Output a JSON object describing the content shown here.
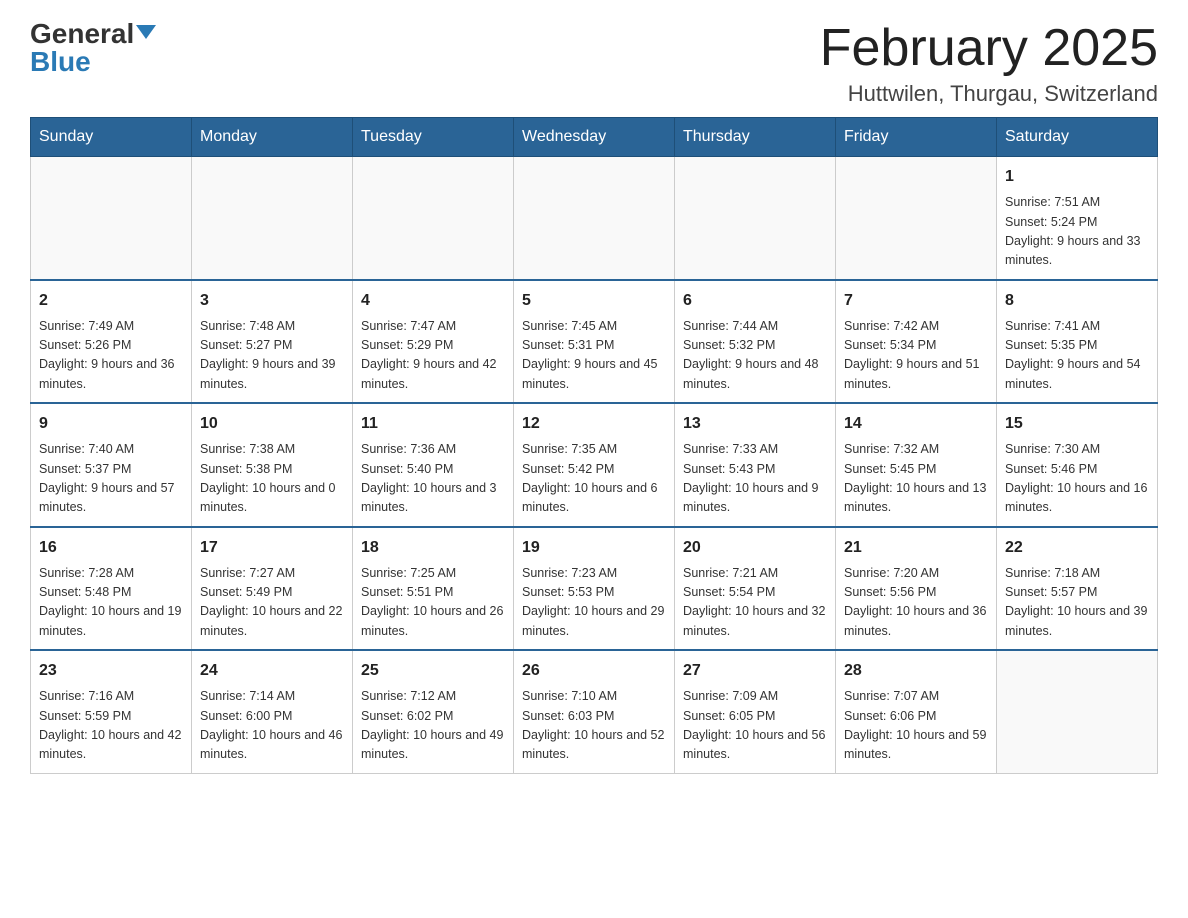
{
  "header": {
    "logo_general": "General",
    "logo_blue": "Blue",
    "month_title": "February 2025",
    "location": "Huttwilen, Thurgau, Switzerland"
  },
  "days_of_week": [
    "Sunday",
    "Monday",
    "Tuesday",
    "Wednesday",
    "Thursday",
    "Friday",
    "Saturday"
  ],
  "weeks": [
    [
      {
        "day": "",
        "info": ""
      },
      {
        "day": "",
        "info": ""
      },
      {
        "day": "",
        "info": ""
      },
      {
        "day": "",
        "info": ""
      },
      {
        "day": "",
        "info": ""
      },
      {
        "day": "",
        "info": ""
      },
      {
        "day": "1",
        "info": "Sunrise: 7:51 AM\nSunset: 5:24 PM\nDaylight: 9 hours and 33 minutes."
      }
    ],
    [
      {
        "day": "2",
        "info": "Sunrise: 7:49 AM\nSunset: 5:26 PM\nDaylight: 9 hours and 36 minutes."
      },
      {
        "day": "3",
        "info": "Sunrise: 7:48 AM\nSunset: 5:27 PM\nDaylight: 9 hours and 39 minutes."
      },
      {
        "day": "4",
        "info": "Sunrise: 7:47 AM\nSunset: 5:29 PM\nDaylight: 9 hours and 42 minutes."
      },
      {
        "day": "5",
        "info": "Sunrise: 7:45 AM\nSunset: 5:31 PM\nDaylight: 9 hours and 45 minutes."
      },
      {
        "day": "6",
        "info": "Sunrise: 7:44 AM\nSunset: 5:32 PM\nDaylight: 9 hours and 48 minutes."
      },
      {
        "day": "7",
        "info": "Sunrise: 7:42 AM\nSunset: 5:34 PM\nDaylight: 9 hours and 51 minutes."
      },
      {
        "day": "8",
        "info": "Sunrise: 7:41 AM\nSunset: 5:35 PM\nDaylight: 9 hours and 54 minutes."
      }
    ],
    [
      {
        "day": "9",
        "info": "Sunrise: 7:40 AM\nSunset: 5:37 PM\nDaylight: 9 hours and 57 minutes."
      },
      {
        "day": "10",
        "info": "Sunrise: 7:38 AM\nSunset: 5:38 PM\nDaylight: 10 hours and 0 minutes."
      },
      {
        "day": "11",
        "info": "Sunrise: 7:36 AM\nSunset: 5:40 PM\nDaylight: 10 hours and 3 minutes."
      },
      {
        "day": "12",
        "info": "Sunrise: 7:35 AM\nSunset: 5:42 PM\nDaylight: 10 hours and 6 minutes."
      },
      {
        "day": "13",
        "info": "Sunrise: 7:33 AM\nSunset: 5:43 PM\nDaylight: 10 hours and 9 minutes."
      },
      {
        "day": "14",
        "info": "Sunrise: 7:32 AM\nSunset: 5:45 PM\nDaylight: 10 hours and 13 minutes."
      },
      {
        "day": "15",
        "info": "Sunrise: 7:30 AM\nSunset: 5:46 PM\nDaylight: 10 hours and 16 minutes."
      }
    ],
    [
      {
        "day": "16",
        "info": "Sunrise: 7:28 AM\nSunset: 5:48 PM\nDaylight: 10 hours and 19 minutes."
      },
      {
        "day": "17",
        "info": "Sunrise: 7:27 AM\nSunset: 5:49 PM\nDaylight: 10 hours and 22 minutes."
      },
      {
        "day": "18",
        "info": "Sunrise: 7:25 AM\nSunset: 5:51 PM\nDaylight: 10 hours and 26 minutes."
      },
      {
        "day": "19",
        "info": "Sunrise: 7:23 AM\nSunset: 5:53 PM\nDaylight: 10 hours and 29 minutes."
      },
      {
        "day": "20",
        "info": "Sunrise: 7:21 AM\nSunset: 5:54 PM\nDaylight: 10 hours and 32 minutes."
      },
      {
        "day": "21",
        "info": "Sunrise: 7:20 AM\nSunset: 5:56 PM\nDaylight: 10 hours and 36 minutes."
      },
      {
        "day": "22",
        "info": "Sunrise: 7:18 AM\nSunset: 5:57 PM\nDaylight: 10 hours and 39 minutes."
      }
    ],
    [
      {
        "day": "23",
        "info": "Sunrise: 7:16 AM\nSunset: 5:59 PM\nDaylight: 10 hours and 42 minutes."
      },
      {
        "day": "24",
        "info": "Sunrise: 7:14 AM\nSunset: 6:00 PM\nDaylight: 10 hours and 46 minutes."
      },
      {
        "day": "25",
        "info": "Sunrise: 7:12 AM\nSunset: 6:02 PM\nDaylight: 10 hours and 49 minutes."
      },
      {
        "day": "26",
        "info": "Sunrise: 7:10 AM\nSunset: 6:03 PM\nDaylight: 10 hours and 52 minutes."
      },
      {
        "day": "27",
        "info": "Sunrise: 7:09 AM\nSunset: 6:05 PM\nDaylight: 10 hours and 56 minutes."
      },
      {
        "day": "28",
        "info": "Sunrise: 7:07 AM\nSunset: 6:06 PM\nDaylight: 10 hours and 59 minutes."
      },
      {
        "day": "",
        "info": ""
      }
    ]
  ]
}
